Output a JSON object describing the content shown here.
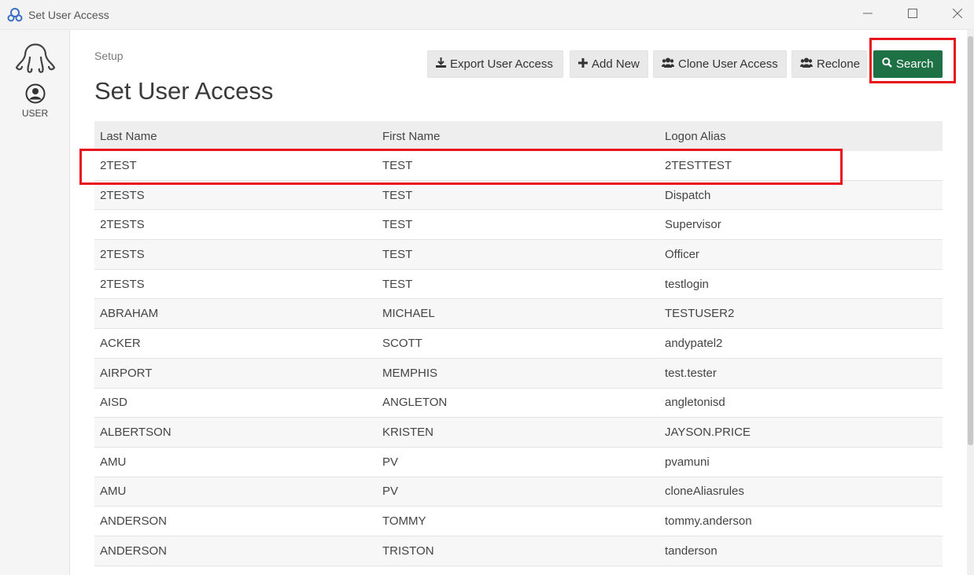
{
  "window": {
    "title": "Set User Access",
    "controls": [
      "minimize-icon",
      "maximize-icon",
      "close-icon"
    ]
  },
  "sidebar": {
    "logo": "octopus-logo-icon",
    "user_label": "USER"
  },
  "main": {
    "breadcrumb": "Setup",
    "title": "Set User Access"
  },
  "toolbar": {
    "export_label": "Export User Access",
    "add_label": "Add New",
    "clone_label": "Clone User Access",
    "reclone_label": "Reclone",
    "search_label": "Search",
    "search_color": "#1e7145"
  },
  "table": {
    "columns": [
      "Last Name",
      "First Name",
      "Logon Alias"
    ],
    "rows": [
      [
        "2TEST",
        "TEST",
        "2TESTTEST"
      ],
      [
        "2TESTS",
        "TEST",
        "Dispatch"
      ],
      [
        "2TESTS",
        "TEST",
        "Supervisor"
      ],
      [
        "2TESTS",
        "TEST",
        "Officer"
      ],
      [
        "2TESTS",
        "TEST",
        "testlogin"
      ],
      [
        "ABRAHAM",
        "MICHAEL",
        "TESTUSER2"
      ],
      [
        "ACKER",
        "SCOTT",
        "andypatel2"
      ],
      [
        "AIRPORT",
        "MEMPHIS",
        "test.tester"
      ],
      [
        "AISD",
        "ANGLETON",
        "angletonisd"
      ],
      [
        "ALBERTSON",
        "KRISTEN",
        "JAYSON.PRICE"
      ],
      [
        "AMU",
        "PV",
        "pvamuni"
      ],
      [
        "AMU",
        "PV",
        "cloneAliasrules"
      ],
      [
        "ANDERSON",
        "TOMMY",
        "tommy.anderson"
      ],
      [
        "ANDERSON",
        "TRISTON",
        "tanderson"
      ]
    ]
  },
  "highlight_color": "#e8141b"
}
